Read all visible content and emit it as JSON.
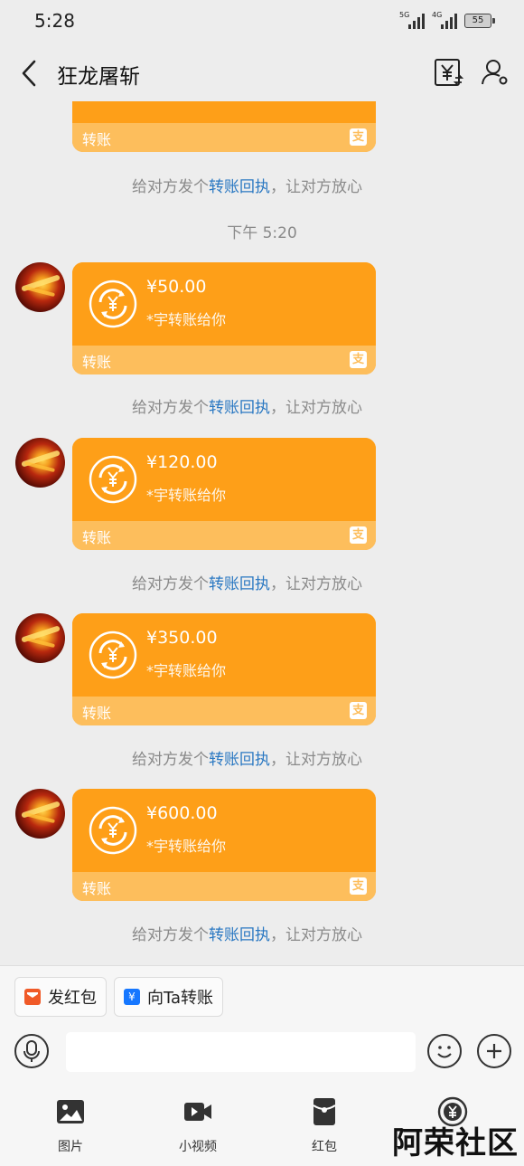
{
  "status_bar": {
    "time": "5:28",
    "signal_1_label": "5G",
    "signal_2_label": "4G",
    "battery": "55"
  },
  "header": {
    "title": "狂龙屠斩",
    "back_icon": "back-arrow-icon",
    "bill_icon": "yuan-bill-icon",
    "profile_icon": "user-profile-icon"
  },
  "chat": {
    "top_partial_card": {
      "label": "转账"
    },
    "receipt_note": {
      "pre": "给对方发个",
      "link": "转账回执",
      "post": "，让对方放心"
    },
    "timestamp": "下午 5:20",
    "transfers": [
      {
        "amount": "¥50.00",
        "desc": "*宇转账给你",
        "label": "转账"
      },
      {
        "amount": "¥120.00",
        "desc": "*宇转账给你",
        "label": "转账"
      },
      {
        "amount": "¥350.00",
        "desc": "*宇转账给你",
        "label": "转账"
      },
      {
        "amount": "¥600.00",
        "desc": "*宇转账给你",
        "label": "转账"
      }
    ]
  },
  "quick_actions": [
    {
      "label": "发红包",
      "icon": "red-packet-icon",
      "color": "#f05a28"
    },
    {
      "label": "向Ta转账",
      "icon": "yuan-transfer-icon",
      "color": "#1677ff"
    }
  ],
  "input": {
    "placeholder": ""
  },
  "toolbar": [
    {
      "label": "图片",
      "icon": "image-icon"
    },
    {
      "label": "小视频",
      "icon": "video-icon"
    },
    {
      "label": "红包",
      "icon": "red-envelope-icon"
    },
    {
      "label": "",
      "icon": "transfer-icon"
    }
  ],
  "watermark": "阿荣社区",
  "colors": {
    "card_orange": "#fe9f18",
    "card_footer": "#fdbe5c",
    "link_blue": "#2a78c2",
    "background": "#ededed"
  }
}
